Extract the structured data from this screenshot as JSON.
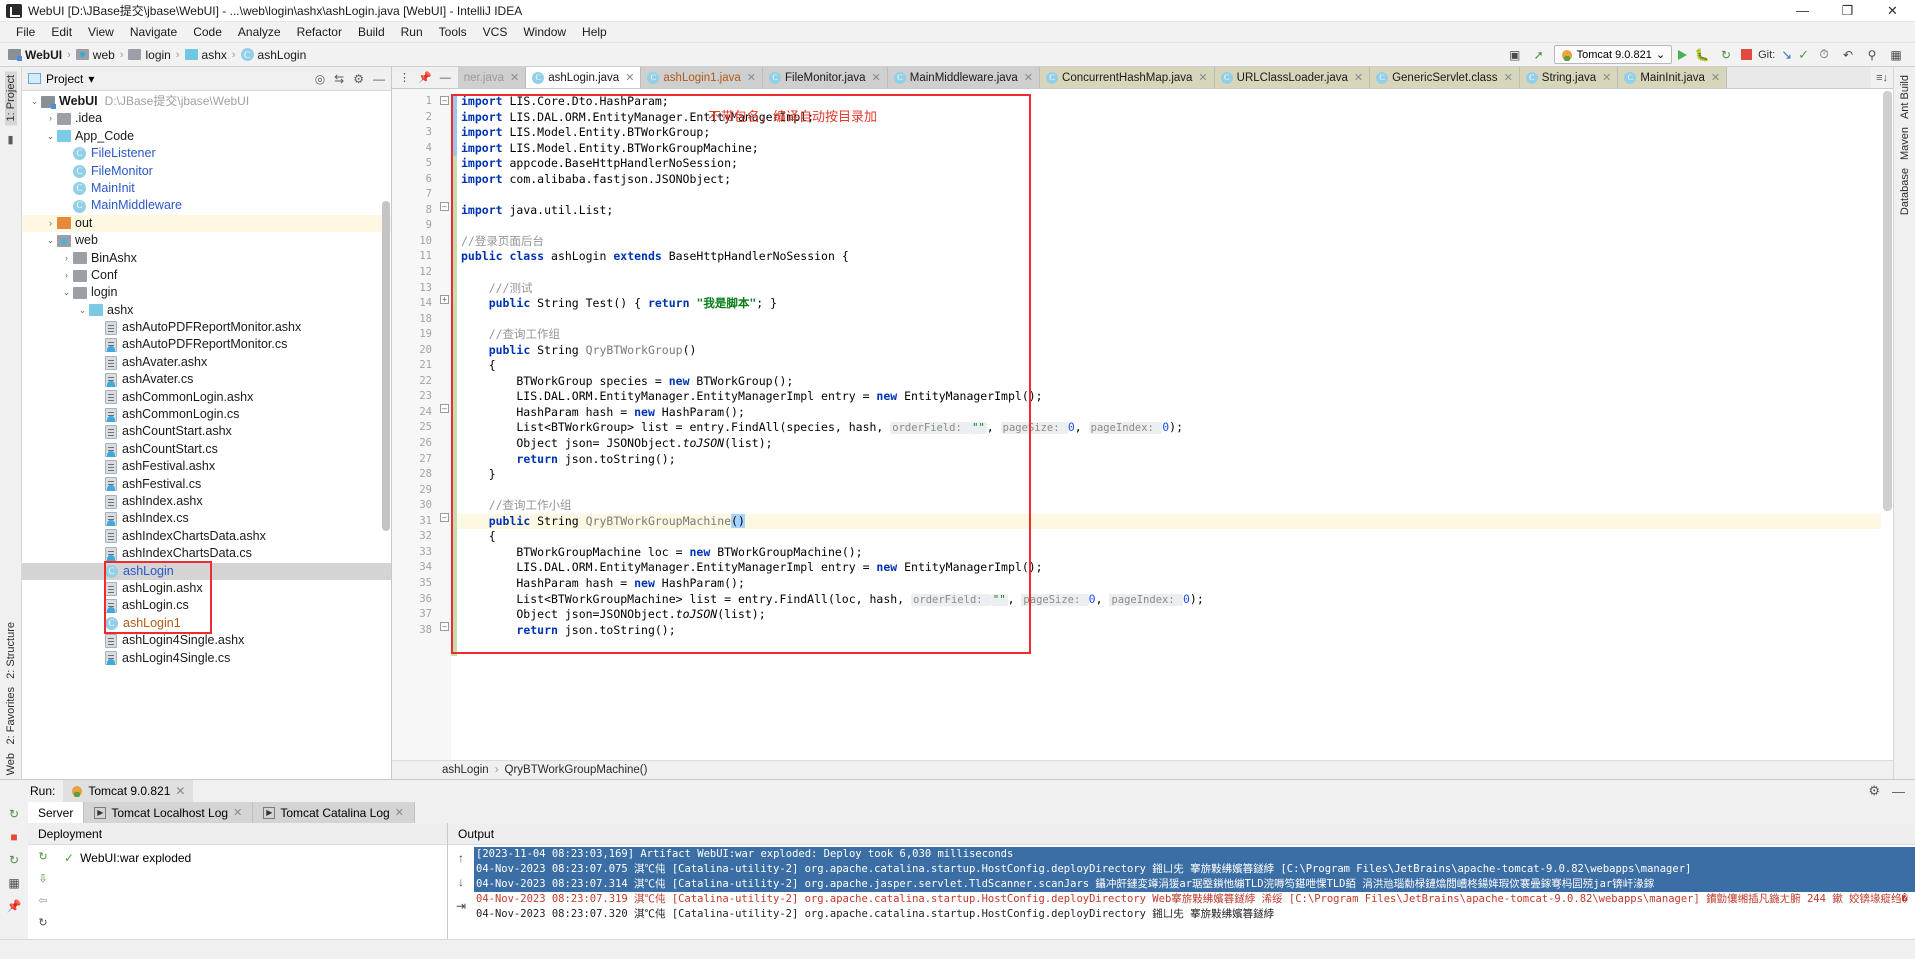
{
  "window": {
    "title": "WebUI [D:\\JBase提交\\jbase\\WebUI] - ...\\web\\login\\ashx\\ashLogin.java [WebUI] - IntelliJ IDEA",
    "minimize": "—",
    "maximize": "❐",
    "close": "✕"
  },
  "menu": {
    "items": [
      "File",
      "Edit",
      "View",
      "Navigate",
      "Code",
      "Analyze",
      "Refactor",
      "Build",
      "Run",
      "Tools",
      "VCS",
      "Window",
      "Help"
    ]
  },
  "breadcrumb": {
    "items": [
      {
        "label": "WebUI",
        "icon": "project-folder-icon",
        "bold": true
      },
      {
        "label": "web",
        "icon": "web-folder-icon",
        "bold": false
      },
      {
        "label": "login",
        "icon": "folder-icon",
        "bold": false
      },
      {
        "label": "ashx",
        "icon": "folder-cyan-icon",
        "bold": false
      },
      {
        "label": "ashLogin",
        "icon": "class-icon",
        "bold": false
      }
    ],
    "separator": "›"
  },
  "toolbar": {
    "run_config": "Tomcat 9.0.821",
    "git_label": "Git:",
    "dropdown_caret": "⌄"
  },
  "project_panel": {
    "title": "Project",
    "caret": "▾",
    "tree": [
      {
        "depth": 0,
        "arrow": "⌄",
        "icon": "dir-proj",
        "label": "WebUI",
        "bold": true,
        "path": "D:\\JBase提交\\jbase\\WebUI"
      },
      {
        "depth": 1,
        "arrow": "›",
        "icon": "dir",
        "label": ".idea"
      },
      {
        "depth": 1,
        "arrow": "⌄",
        "icon": "dir-cyan",
        "label": "App_Code"
      },
      {
        "depth": 2,
        "arrow": "",
        "icon": "class",
        "label": "FileListener",
        "color": "blue"
      },
      {
        "depth": 2,
        "arrow": "",
        "icon": "class",
        "label": "FileMonitor",
        "color": "blue"
      },
      {
        "depth": 2,
        "arrow": "",
        "icon": "class",
        "label": "MainInit",
        "color": "blue"
      },
      {
        "depth": 2,
        "arrow": "",
        "icon": "class",
        "label": "MainMiddleware",
        "color": "blue"
      },
      {
        "depth": 1,
        "arrow": "›",
        "icon": "dir-orange",
        "label": "out",
        "highlight": true
      },
      {
        "depth": 1,
        "arrow": "⌄",
        "icon": "dir-web",
        "label": "web"
      },
      {
        "depth": 2,
        "arrow": "›",
        "icon": "dir",
        "label": "BinAshx"
      },
      {
        "depth": 2,
        "arrow": "›",
        "icon": "dir",
        "label": "Conf"
      },
      {
        "depth": 2,
        "arrow": "⌄",
        "icon": "dir",
        "label": "login"
      },
      {
        "depth": 3,
        "arrow": "⌄",
        "icon": "dir-cyan",
        "label": "ashx"
      },
      {
        "depth": 4,
        "arrow": "",
        "icon": "file",
        "label": "ashAutoPDFReportMonitor.ashx"
      },
      {
        "depth": 4,
        "arrow": "",
        "icon": "file-cs",
        "label": "ashAutoPDFReportMonitor.cs"
      },
      {
        "depth": 4,
        "arrow": "",
        "icon": "file",
        "label": "ashAvater.ashx"
      },
      {
        "depth": 4,
        "arrow": "",
        "icon": "file-cs",
        "label": "ashAvater.cs"
      },
      {
        "depth": 4,
        "arrow": "",
        "icon": "file",
        "label": "ashCommonLogin.ashx"
      },
      {
        "depth": 4,
        "arrow": "",
        "icon": "file-cs",
        "label": "ashCommonLogin.cs"
      },
      {
        "depth": 4,
        "arrow": "",
        "icon": "file",
        "label": "ashCountStart.ashx"
      },
      {
        "depth": 4,
        "arrow": "",
        "icon": "file-cs",
        "label": "ashCountStart.cs"
      },
      {
        "depth": 4,
        "arrow": "",
        "icon": "file",
        "label": "ashFestival.ashx"
      },
      {
        "depth": 4,
        "arrow": "",
        "icon": "file-cs",
        "label": "ashFestival.cs"
      },
      {
        "depth": 4,
        "arrow": "",
        "icon": "file",
        "label": "ashIndex.ashx"
      },
      {
        "depth": 4,
        "arrow": "",
        "icon": "file-cs",
        "label": "ashIndex.cs"
      },
      {
        "depth": 4,
        "arrow": "",
        "icon": "file",
        "label": "ashIndexChartsData.ashx"
      },
      {
        "depth": 4,
        "arrow": "",
        "icon": "file-cs",
        "label": "ashIndexChartsData.cs"
      },
      {
        "depth": 4,
        "arrow": "",
        "icon": "class",
        "label": "ashLogin",
        "color": "blue",
        "selected": true
      },
      {
        "depth": 4,
        "arrow": "",
        "icon": "file",
        "label": "ashLogin.ashx"
      },
      {
        "depth": 4,
        "arrow": "",
        "icon": "file-cs",
        "label": "ashLogin.cs"
      },
      {
        "depth": 4,
        "arrow": "",
        "icon": "class",
        "label": "ashLogin1",
        "color": "orange"
      },
      {
        "depth": 4,
        "arrow": "",
        "icon": "file",
        "label": "ashLogin4Single.ashx"
      },
      {
        "depth": 4,
        "arrow": "",
        "icon": "file-cs",
        "label": "ashLogin4Single.cs"
      }
    ]
  },
  "editor_tabs": [
    {
      "label": "ner.java",
      "state": "cut"
    },
    {
      "label": "ashLogin.java",
      "state": "active"
    },
    {
      "label": "ashLogin1.java",
      "state": "modified"
    },
    {
      "label": "FileMonitor.java",
      "state": "normal"
    },
    {
      "label": "MainMiddleware.java",
      "state": "normal"
    },
    {
      "label": "ConcurrentHashMap.java",
      "state": "yellow"
    },
    {
      "label": "URLClassLoader.java",
      "state": "yellow"
    },
    {
      "label": "GenericServlet.class",
      "state": "yellow"
    },
    {
      "label": "String.java",
      "state": "yellow"
    },
    {
      "label": "MainInit.java",
      "state": "yellow"
    }
  ],
  "code": {
    "annotation": "不带包名，编译自动按目录加",
    "lines": [
      {
        "num": "1",
        "tokens": [
          [
            "kw",
            "import"
          ],
          [
            "plain",
            " LIS.Core.Dto.HashParam;"
          ]
        ]
      },
      {
        "num": "2",
        "tokens": [
          [
            "kw",
            "import"
          ],
          [
            "plain",
            " LIS.DAL.ORM.EntityManager.EntityManagerImpl;"
          ]
        ]
      },
      {
        "num": "3",
        "tokens": [
          [
            "kw",
            "import"
          ],
          [
            "plain",
            " LIS.Model.Entity.BTWorkGroup;"
          ]
        ]
      },
      {
        "num": "4",
        "tokens": [
          [
            "kw",
            "import"
          ],
          [
            "plain",
            " LIS.Model.Entity.BTWorkGroupMachine;"
          ]
        ]
      },
      {
        "num": "5",
        "tokens": [
          [
            "kw",
            "import"
          ],
          [
            "plain",
            " appcode.BaseHttpHandlerNoSession;"
          ]
        ]
      },
      {
        "num": "6",
        "tokens": [
          [
            "kw",
            "import"
          ],
          [
            "plain",
            " com.alibaba.fastjson.JSONObject;"
          ]
        ]
      },
      {
        "num": "7",
        "tokens": []
      },
      {
        "num": "8",
        "tokens": [
          [
            "kw",
            "import"
          ],
          [
            "plain",
            " java.util.List;"
          ]
        ]
      },
      {
        "num": "9",
        "tokens": []
      },
      {
        "num": "10",
        "tokens": [
          [
            "cmt",
            "//登录页面后台"
          ]
        ]
      },
      {
        "num": "11",
        "tokens": [
          [
            "kw",
            "public class"
          ],
          [
            "plain",
            " ashLogin "
          ],
          [
            "kw",
            "extends"
          ],
          [
            "plain",
            " BaseHttpHandlerNoSession {"
          ]
        ]
      },
      {
        "num": "12",
        "tokens": []
      },
      {
        "num": "13",
        "tokens": [
          [
            "cmt",
            "    ///测试"
          ]
        ]
      },
      {
        "num": "14",
        "tokens": [
          [
            "plain",
            "    "
          ],
          [
            "kw",
            "public"
          ],
          [
            "plain",
            " String Test() { "
          ],
          [
            "kw",
            "return"
          ],
          [
            "plain",
            " "
          ],
          [
            "str",
            "\"我是脚本\""
          ],
          [
            "plain",
            "; }"
          ]
        ]
      },
      {
        "num": "18",
        "tokens": []
      },
      {
        "num": "19",
        "tokens": [
          [
            "cmt",
            "    //查询工作组"
          ]
        ]
      },
      {
        "num": "20",
        "tokens": [
          [
            "plain",
            "    "
          ],
          [
            "kw",
            "public"
          ],
          [
            "plain",
            " String "
          ],
          [
            "mth",
            "QryBTWorkGroup"
          ],
          [
            "plain",
            "()"
          ]
        ]
      },
      {
        "num": "21",
        "tokens": [
          [
            "plain",
            "    {"
          ]
        ]
      },
      {
        "num": "22",
        "tokens": [
          [
            "plain",
            "        BTWorkGroup species = "
          ],
          [
            "kw",
            "new"
          ],
          [
            "plain",
            " BTWorkGroup();"
          ]
        ]
      },
      {
        "num": "23",
        "tokens": [
          [
            "plain",
            "        LIS.DAL.ORM.EntityManager.EntityManagerImpl entry = "
          ],
          [
            "kw",
            "new"
          ],
          [
            "plain",
            " EntityManagerImpl();"
          ]
        ]
      },
      {
        "num": "24",
        "tokens": [
          [
            "plain",
            "        HashParam hash = "
          ],
          [
            "kw",
            "new"
          ],
          [
            "plain",
            " HashParam();"
          ]
        ]
      },
      {
        "num": "25",
        "tokens": [
          [
            "plain",
            "        List<BTWorkGroup> list = entry.FindAll(species, hash, "
          ],
          [
            "hint",
            "orderField: "
          ],
          [
            "hintv",
            "\"\""
          ],
          [
            "plain",
            ", "
          ],
          [
            "hint",
            "pageSize: "
          ],
          [
            "num",
            "0"
          ],
          [
            "plain",
            ", "
          ],
          [
            "hint",
            "pageIndex: "
          ],
          [
            "num",
            "0"
          ],
          [
            "plain",
            ");"
          ]
        ]
      },
      {
        "num": "26",
        "tokens": [
          [
            "plain",
            "        Object json= JSONObject."
          ],
          [
            "ital",
            "toJSON"
          ],
          [
            "plain",
            "(list);"
          ]
        ]
      },
      {
        "num": "27",
        "tokens": [
          [
            "plain",
            "        "
          ],
          [
            "kw",
            "return"
          ],
          [
            "plain",
            " json.toString();"
          ]
        ]
      },
      {
        "num": "28",
        "tokens": [
          [
            "plain",
            "    }"
          ]
        ]
      },
      {
        "num": "29",
        "tokens": []
      },
      {
        "num": "30",
        "tokens": [
          [
            "cmt",
            "    //查询工作小组"
          ]
        ]
      },
      {
        "num": "31",
        "tokens": [
          [
            "plain",
            "    "
          ],
          [
            "kw",
            "public"
          ],
          [
            "plain",
            " String "
          ],
          [
            "mth",
            "QryBTWorkGroupMachine"
          ],
          [
            "seltok",
            "()"
          ]
        ],
        "highlight": true
      },
      {
        "num": "32",
        "tokens": [
          [
            "plain",
            "    {"
          ]
        ]
      },
      {
        "num": "33",
        "tokens": [
          [
            "plain",
            "        BTWorkGroupMachine loc = "
          ],
          [
            "kw",
            "new"
          ],
          [
            "plain",
            " BTWorkGroupMachine();"
          ]
        ]
      },
      {
        "num": "34",
        "tokens": [
          [
            "plain",
            "        LIS.DAL.ORM.EntityManager.EntityManagerImpl entry = "
          ],
          [
            "kw",
            "new"
          ],
          [
            "plain",
            " EntityManagerImpl();"
          ]
        ]
      },
      {
        "num": "35",
        "tokens": [
          [
            "plain",
            "        HashParam hash = "
          ],
          [
            "kw",
            "new"
          ],
          [
            "plain",
            " HashParam();"
          ]
        ]
      },
      {
        "num": "36",
        "tokens": [
          [
            "plain",
            "        List<BTWorkGroupMachine> list = entry.FindAll(loc, hash, "
          ],
          [
            "hint",
            "orderField: "
          ],
          [
            "hintv",
            "\"\""
          ],
          [
            "plain",
            ", "
          ],
          [
            "hint",
            "pageSize: "
          ],
          [
            "num",
            "0"
          ],
          [
            "plain",
            ", "
          ],
          [
            "hint",
            "pageIndex: "
          ],
          [
            "num",
            "0"
          ],
          [
            "plain",
            ");"
          ]
        ]
      },
      {
        "num": "37",
        "tokens": [
          [
            "plain",
            "        Object json=JSONObject."
          ],
          [
            "ital",
            "toJSON"
          ],
          [
            "plain",
            "(list);"
          ]
        ]
      },
      {
        "num": "38",
        "tokens": [
          [
            "plain",
            "        "
          ],
          [
            "kw",
            "return"
          ],
          [
            "plain",
            " json.toString();"
          ]
        ]
      }
    ]
  },
  "editor_breadcrumb": {
    "class": "ashLogin",
    "separator": "›",
    "method": "QryBTWorkGroupMachine()"
  },
  "rails": {
    "left_top": "1: Project",
    "left_bottom1": "2: Structure",
    "left_bottom2": "2: Favorites",
    "left_bottom3": "Web",
    "right_top": "Ant Build",
    "right_mid": "Maven",
    "right_bottom": "Database"
  },
  "run_panel": {
    "run_label": "Run:",
    "run_tab": "Tomcat 9.0.821",
    "subtabs": [
      {
        "label": "Server",
        "active": true,
        "closable": false
      },
      {
        "label": "Tomcat Localhost Log",
        "active": false,
        "closable": true
      },
      {
        "label": "Tomcat Catalina Log",
        "active": false,
        "closable": true
      }
    ],
    "deployment_title": "Deployment",
    "output_title": "Output",
    "deployment_rows": [
      {
        "label": "WebUI:war exploded",
        "status": "ok"
      }
    ],
    "output_lines": [
      {
        "text": "[2023-11-04 08:23:03,169] Artifact WebUI:war exploded: Deploy took 6,030 milliseconds",
        "style": "sel"
      },
      {
        "text": "04-Nov-2023 08:23:07.075 淇℃伅 [Catalina-utility-2] org.apache.catalina.startup.HostConfig.deployDirectory 鎺ㄩ兂 搴旂敤绋嬪簭鐩綍 [C:\\Program Files\\JetBrains\\apache-tomcat-9.0.82\\webapps\\manager]",
        "style": "sel"
      },
      {
        "text": "04-Nov-2023 08:23:07.314 淇℃伅 [Catalina-utility-2] org.apache.jasper.servlet.TldScanner.scanJars 鑷冲皯鏈変竴涓猨ar琚壂鎻忚繃TLD浣嗕笉鍖呭惈TLD銆 涓洪兘瑙勬椂鏈熻閲嶆柊鍚姩瑕佽褰曡鎵弿杩囩殑jar锛屽湪鎵",
        "style": "sel"
      },
      {
        "text": "04-Nov-2023 08:23:07.319 淇℃伅 [Catalina-utility-2] org.apache.catalina.startup.HostConfig.deployDirectory Web搴旂敤绋嬪簭鐩綍 浠绥 [C:\\Program Files\\JetBrains\\apache-tomcat-9.0.82\\webapps\\manager] 鐨勯儴缃插凡鍦ㄤ腑 244 鏉 姣锛堟瘲绉�",
        "style": "red"
      },
      {
        "text": "04-Nov-2023 08:23:07.320 淇℃伅 [Catalina-utility-2] org.apache.catalina.startup.HostConfig.deployDirectory 鎺ㄩ兂 搴旂敤绋嬪簭鐩綍",
        "style": "grey"
      }
    ]
  }
}
